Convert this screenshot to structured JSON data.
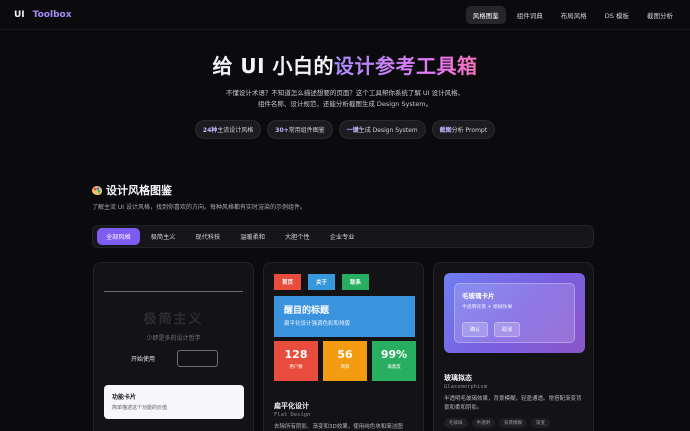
{
  "nav": {
    "brand_ui": "UI",
    "brand_name": "Toolbox",
    "links": [
      "风格图鉴",
      "组件词典",
      "布局风格",
      "DS 模板",
      "截图分析"
    ],
    "active_index": 0
  },
  "hero": {
    "title_plain": "给 UI 小白的",
    "title_accent": "设计参考工具箱",
    "description": "不懂设计术语？不知道怎么描述想要的页面？这个工具帮你系统了解 UI 设计风格、组件名称、设计规范，还能分析截图生成 Design System。",
    "pills": [
      {
        "bold": "24种",
        "text": "主流设计风格"
      },
      {
        "bold": "30+",
        "text": "常用组件图鉴"
      },
      {
        "bold": "一键",
        "text": "生成 Design System"
      },
      {
        "bold": "截图",
        "text": "分析 Prompt"
      }
    ]
  },
  "section": {
    "title": "设计风格图鉴",
    "subtitle": "了解主流 UI 设计风格，找到你喜欢的方向。每种风格都有实时渲染的示例组件。",
    "filters": [
      "全部风格",
      "极简主义",
      "现代科技",
      "温暖柔和",
      "大胆个性",
      "企业专业"
    ],
    "active_filter": 0
  },
  "cards": {
    "minimal": {
      "title": "极简主义",
      "subtitle": "少即是多的设计哲学",
      "btn_primary": "开始使用",
      "inner_title": "功能卡片",
      "inner_desc": "简单描述这个功能的价值"
    },
    "flat": {
      "tags": [
        {
          "label": "首页",
          "color": "#e74c3c"
        },
        {
          "label": "关于",
          "color": "#3498db"
        },
        {
          "label": "联系",
          "color": "#27ae60"
        }
      ],
      "banner_title": "醒目的标题",
      "banner_desc": "扁平化设计强调色彩和排版",
      "stats": [
        {
          "value": "128",
          "label": "用户数",
          "color": "#e74c3c"
        },
        {
          "value": "56",
          "label": "项目",
          "color": "#f39c12"
        },
        {
          "value": "99%",
          "label": "满意度",
          "color": "#27ae60"
        }
      ],
      "name": "扁平化设计",
      "name_en": "Flat Design",
      "desc": "去除所有阴影、渐变和3D效果，使用纯色块和简洁图"
    },
    "glass": {
      "panel_title": "毛玻璃卡片",
      "panel_desc": "半透明背景 + 模糊效果",
      "btn_confirm": "确认",
      "btn_cancel": "取消",
      "name": "玻璃拟态",
      "name_en": "Glassmorphism",
      "desc": "半透明毛玻璃效果，背景模糊，轻盈通透。常搭配渐变背景和柔和阴影。",
      "tags": [
        "毛玻璃",
        "半透明",
        "背景模糊",
        "渐变"
      ]
    }
  }
}
